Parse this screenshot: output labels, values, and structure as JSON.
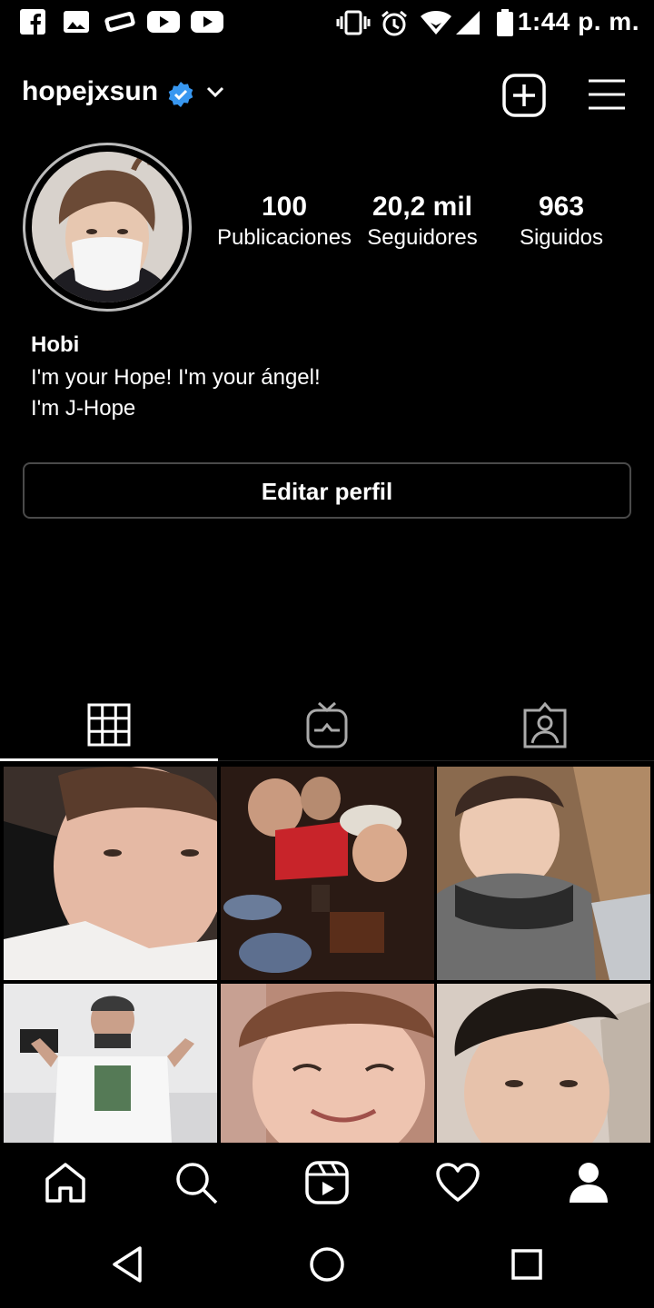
{
  "status_bar": {
    "time": "1:44 p. m.",
    "left_icons": [
      "facebook-icon",
      "gallery-icon",
      "gamepad-icon",
      "youtube-icon",
      "youtube-icon"
    ],
    "right_icons": [
      "vibrate-icon",
      "alarm-icon",
      "wifi-icon",
      "signal-icon",
      "battery-icon"
    ]
  },
  "header": {
    "username": "hopejxsun",
    "verified": true,
    "icons": [
      "verified-badge-icon",
      "chevron-down-icon",
      "new-post-icon",
      "menu-icon"
    ]
  },
  "profile": {
    "stats": [
      {
        "value": "100",
        "label": "Publicaciones"
      },
      {
        "value": "20,2 mil",
        "label": "Seguidores"
      },
      {
        "value": "963",
        "label": "Siguidos"
      }
    ],
    "name": "Hobi",
    "bio_lines": [
      "I'm your Hope! I'm your ángel!",
      "I'm J-Hope"
    ],
    "edit_button": "Editar perfil"
  },
  "tabs": [
    {
      "name": "grid",
      "icon": "grid-icon",
      "active": true
    },
    {
      "name": "igtv",
      "icon": "igtv-icon",
      "active": false
    },
    {
      "name": "tagged",
      "icon": "tagged-icon",
      "active": false
    }
  ],
  "posts": [
    {
      "id": "post-1"
    },
    {
      "id": "post-2"
    },
    {
      "id": "post-3"
    },
    {
      "id": "post-4"
    },
    {
      "id": "post-5"
    },
    {
      "id": "post-6"
    }
  ],
  "bottom_nav": [
    "home-icon",
    "search-icon",
    "reels-icon",
    "heart-icon",
    "profile-icon"
  ],
  "android_nav": [
    "back-icon",
    "home-circle-icon",
    "recents-icon"
  ],
  "colors": {
    "background": "#000000",
    "text": "#ffffff",
    "verified": "#3897f0",
    "button_border": "#4a4a4a"
  }
}
